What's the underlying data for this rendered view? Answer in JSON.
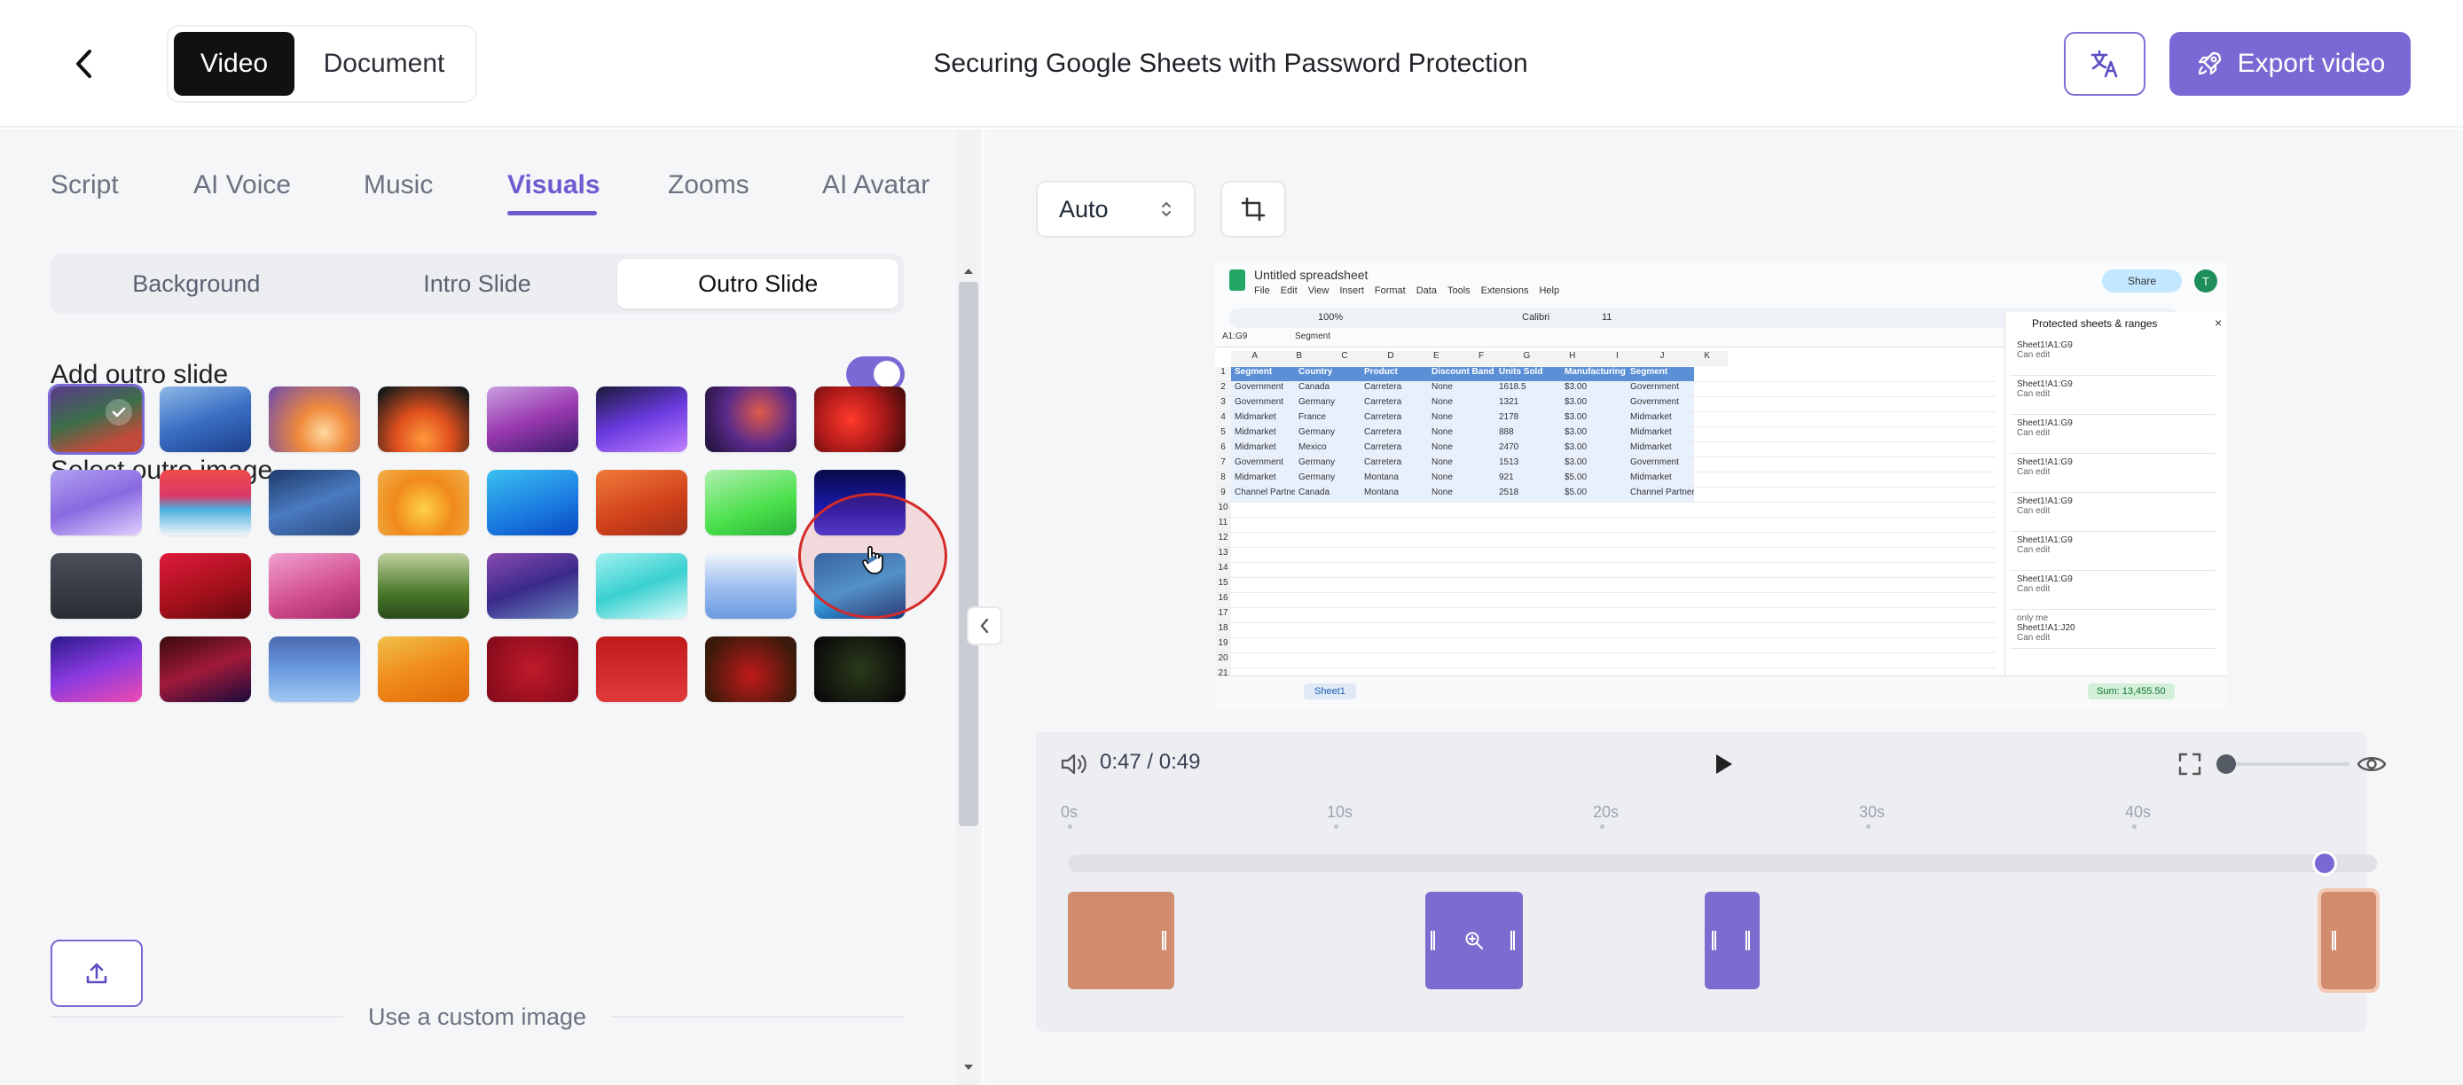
{
  "header": {
    "back_label": "",
    "mode_tabs": [
      {
        "label": "Video"
      },
      {
        "label": "Document"
      }
    ],
    "title": "Securing Google Sheets with Password Protection",
    "export_label": "Export video"
  },
  "editor_tabs": [
    {
      "label": "Script"
    },
    {
      "label": "AI Voice"
    },
    {
      "label": "Music"
    },
    {
      "label": "Visuals"
    },
    {
      "label": "Zooms"
    },
    {
      "label": "AI Avatar"
    }
  ],
  "sub_tabs": [
    {
      "label": "Background"
    },
    {
      "label": "Intro Slide"
    },
    {
      "label": "Outro Slide"
    }
  ],
  "outro": {
    "add_label": "Add outro slide",
    "add_enabled": true,
    "select_label": "Select outro image",
    "custom_label": "Use a custom image",
    "selected_index": 0
  },
  "player": {
    "aspect": "Auto",
    "time": "0:47 / 0:49",
    "ticks": [
      "0s",
      "10s",
      "20s",
      "30s",
      "40s"
    ],
    "progress": 0.96
  },
  "spreadsheet": {
    "file_name": "Untitled spreadsheet",
    "menus": [
      "File",
      "Edit",
      "View",
      "Insert",
      "Format",
      "Data",
      "Tools",
      "Extensions",
      "Help"
    ],
    "zoom": "100%",
    "font": "Calibri",
    "font_size": "11",
    "share_label": "Share",
    "name_box": "A1:G9",
    "formula": "Segment",
    "col_letters": [
      "A",
      "B",
      "C",
      "D",
      "E",
      "F",
      "G",
      "H",
      "I",
      "J",
      "K"
    ],
    "headers": [
      "Segment",
      "Country",
      "Product",
      "Discount Band",
      "Units Sold",
      "Manufacturing Price",
      "Segment"
    ],
    "rows": [
      [
        "Government",
        "Canada",
        "Carretera",
        "None",
        "1618.5",
        "$3.00",
        "Government"
      ],
      [
        "Government",
        "Germany",
        "Carretera",
        "None",
        "1321",
        "$3.00",
        "Government"
      ],
      [
        "Midmarket",
        "France",
        "Carretera",
        "None",
        "2178",
        "$3.00",
        "Midmarket"
      ],
      [
        "Midmarket",
        "Germany",
        "Carretera",
        "None",
        "888",
        "$3.00",
        "Midmarket"
      ],
      [
        "Midmarket",
        "Mexico",
        "Carretera",
        "None",
        "2470",
        "$3.00",
        "Midmarket"
      ],
      [
        "Government",
        "Germany",
        "Carretera",
        "None",
        "1513",
        "$3.00",
        "Government"
      ],
      [
        "Midmarket",
        "Germany",
        "Montana",
        "None",
        "921",
        "$5.00",
        "Midmarket"
      ],
      [
        "Channel Partners",
        "Canada",
        "Montana",
        "None",
        "2518",
        "$5.00",
        "Channel Partners"
      ]
    ],
    "panel_title": "Protected sheets & ranges",
    "panel_items": [
      {
        "range": "Sheet1!A1:G9",
        "access": "Can edit"
      },
      {
        "range": "Sheet1!A1:G9",
        "access": "Can edit"
      },
      {
        "range": "Sheet1!A1:G9",
        "access": "Can edit"
      },
      {
        "range": "Sheet1!A1:G9",
        "access": "Can edit"
      },
      {
        "range": "Sheet1!A1:G9",
        "access": "Can edit"
      },
      {
        "range": "Sheet1!A1:G9",
        "access": "Can edit"
      },
      {
        "range": "Sheet1!A1:G9",
        "access": "Can edit"
      },
      {
        "range": "Sheet1!A1:J20",
        "access": "Can edit",
        "note": "only me"
      }
    ],
    "sheet_tab": "Sheet1",
    "sum_label": "Sum: 13,455.50"
  },
  "thumb_gradients": [
    "linear-gradient(160deg,#5a3a8a 0%,#3d6e4a 45%,#c24a3a 80%)",
    "linear-gradient(160deg,#8fb9e6 0%,#3a6fc4 50%,#1d3f8a 100%)",
    "radial-gradient(circle at 60% 70%,#ffd9a0 0%,#f08a3c 35%,#6a4ab0 100%)",
    "radial-gradient(circle at 50% 80%,#ff9a3a 0%,#e0501e 40%,#1a1a1a 90%)",
    "linear-gradient(160deg,#c9a0e0 0%,#9a3ab0 50%,#3a1a6a 100%)",
    "linear-gradient(160deg,#1a1a3a 0%,#6a3ae0 50%,#c080ff 100%)",
    "radial-gradient(circle at 60% 40%,#e05a4a 0%,#5a2a8a 50%,#1a1030 100%)",
    "radial-gradient(circle at 40% 50%,#ff3a2a 0%,#b01a1a 50%,#3a0a0a 100%)",
    "linear-gradient(160deg,#b0a0f0 0%,#8a6ae0 50%,#e0d0ff 100%)",
    "linear-gradient(180deg,#f04a4a 0%,#d83a6a 40%,#4ab0e0 60%,#f0f4f8 100%)",
    "linear-gradient(160deg,#1e3a6a 0%,#4a7ac0 50%,#2a4a80 100%)",
    "radial-gradient(circle at 50% 60%,#ffd04a 0%,#f08a1a 50%,#f0b04a 100%)",
    "linear-gradient(160deg,#3ac0f0 0%,#1a7ae0 60%,#0a4ac0 100%)",
    "linear-gradient(160deg,#f07a3a 0%,#d0401a 60%,#a0301a 100%)",
    "linear-gradient(160deg,#b0f0b0 0%,#4ae04a 60%,#2ab03a 100%)",
    "linear-gradient(180deg,#0a0a4a 0%,#1a1ab0 60%,#3a3ae0 100%)",
    "linear-gradient(180deg,#4a4e58 0%,#2a2d34 100%)",
    "linear-gradient(160deg,#e01a3a 0%,#a0101a 60%,#600a10 100%)",
    "linear-gradient(160deg,#f0a0d0 0%,#d04a8a 60%,#a02a6a 100%)",
    "linear-gradient(180deg,#c0d0a0 0%,#4a7a2a 60%,#2a4a1a 100%)",
    "linear-gradient(160deg,#8a4ab0 0%,#3a2a8a 50%,#6a8ac0 100%)",
    "linear-gradient(160deg,#a0f0f0 0%,#3ad0d0 50%,#e0fafa 100%)",
    "linear-gradient(180deg,#f0f4fa 0%,#a0c0f0 50%,#6a9ae0 100%)",
    "linear-gradient(160deg,#1a6ab0 0%,#3aa0e0 50%,#0a3a80 100%)",
    "linear-gradient(160deg,#2a1a8a 0%,#8a3ae0 50%,#f04ab0 100%)",
    "linear-gradient(160deg,#3a0a0a 0%,#a01a3a 50%,#1a0a3a 100%)",
    "linear-gradient(180deg,#4a6ab0 0%,#6a9ae0 50%,#a0c8f0 100%)",
    "linear-gradient(160deg,#f0c04a 0%,#f08a1a 50%,#e06a0a 100%)",
    "radial-gradient(circle at 50% 50%,#c01a2a 0%,#800a1a 100%)",
    "linear-gradient(180deg,#c01a1a 0%,#e03a3a 100%)",
    "radial-gradient(circle at 50% 60%,#c01a1a 0%,#3a1a0a 80%)",
    "radial-gradient(circle at 50% 50%,#2a3a1a 0%,#0a0a0a 90%)"
  ]
}
